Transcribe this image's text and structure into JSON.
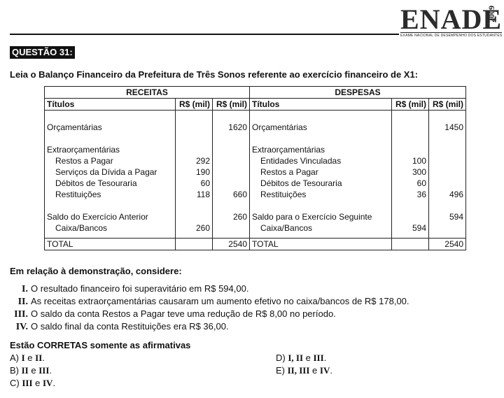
{
  "logo": {
    "word": "ENADE",
    "year": "2009",
    "subtitle": "EXAME NACIONAL DE DESEMPENHO DOS ESTUDANTES"
  },
  "question": {
    "label": "QUESTÃO 31:"
  },
  "intro": "Leia o Balanço Financeiro da Prefeitura de Três Sonos referente ao exercício financeiro de X1:",
  "table": {
    "receitas_header": "RECEITAS",
    "despesas_header": "DESPESAS",
    "col_titulos": "Títulos",
    "col_rs": "R$ (mil)",
    "receitas": [
      {
        "label": "",
        "a": "",
        "b": "",
        "gap": true
      },
      {
        "label": "Orçamentárias",
        "a": "",
        "b": "1620",
        "indent": false
      },
      {
        "label": "",
        "a": "",
        "b": "",
        "gap": true
      },
      {
        "label": "Extraorçamentárias",
        "a": "",
        "b": "",
        "indent": false
      },
      {
        "label": "Restos a Pagar",
        "a": "292",
        "b": "",
        "indent": true
      },
      {
        "label": "Serviços da Dívida a Pagar",
        "a": "190",
        "b": "",
        "indent": true
      },
      {
        "label": "Débitos de Tesouraria",
        "a": "60",
        "b": "",
        "indent": true
      },
      {
        "label": "Restituições",
        "a": "118",
        "b": "660",
        "indent": true
      },
      {
        "label": "",
        "a": "",
        "b": "",
        "gap": true
      },
      {
        "label": "Saldo do Exercício Anterior",
        "a": "",
        "b": "260",
        "indent": false
      },
      {
        "label": "Caixa/Bancos",
        "a": "260",
        "b": "",
        "indent": true
      }
    ],
    "despesas": [
      {
        "label": "",
        "a": "",
        "b": "",
        "gap": true
      },
      {
        "label": "Orçamentárias",
        "a": "",
        "b": "1450",
        "indent": false
      },
      {
        "label": "",
        "a": "",
        "b": "",
        "gap": true
      },
      {
        "label": "Extraorçamentárias",
        "a": "",
        "b": "",
        "indent": false
      },
      {
        "label": "Entidades Vinculadas",
        "a": "100",
        "b": "",
        "indent": true
      },
      {
        "label": "Restos a Pagar",
        "a": "300",
        "b": "",
        "indent": true
      },
      {
        "label": "Débitos de Tesouraria",
        "a": "60",
        "b": "",
        "indent": true
      },
      {
        "label": "Restituições",
        "a": "36",
        "b": "496",
        "indent": true
      },
      {
        "label": "",
        "a": "",
        "b": "",
        "gap": true
      },
      {
        "label": "Saldo para o Exercício Seguinte",
        "a": "",
        "b": "594",
        "indent": false
      },
      {
        "label": "Caixa/Bancos",
        "a": "594",
        "b": "",
        "indent": true
      }
    ],
    "total_label": "TOTAL",
    "total_receitas": "2540",
    "total_despesas": "2540"
  },
  "consider": "Em relação à demonstração, considere:",
  "statements": [
    {
      "num": "I.",
      "text": "O resultado financeiro foi superavitário em R$ 594,00."
    },
    {
      "num": "II.",
      "text": "As receitas extraorçamentárias causaram um aumento efetivo no caixa/bancos de R$ 178,00."
    },
    {
      "num": "III.",
      "text": "O saldo da conta Restos a Pagar teve uma redução de R$ 8,00 no período."
    },
    {
      "num": "IV.",
      "text": "O saldo final da conta Restituições era R$ 36,00."
    }
  ],
  "which": "Estão CORRETAS somente as afirmativas",
  "options": [
    {
      "letter": "A)",
      "p1": "I",
      "mid": " e ",
      "p2": "II",
      "end": "."
    },
    {
      "letter": "B)",
      "p1": "II",
      "mid": " e ",
      "p2": "III",
      "end": "."
    },
    {
      "letter": "C)",
      "p1": "III",
      "mid": " e ",
      "p2": "IV",
      "end": "."
    },
    {
      "letter": "D)",
      "p1": "I, II",
      "mid": " e ",
      "p2": "III",
      "end": "."
    },
    {
      "letter": "E)",
      "p1": "II, III",
      "mid": " e ",
      "p2": "IV",
      "end": "."
    }
  ]
}
